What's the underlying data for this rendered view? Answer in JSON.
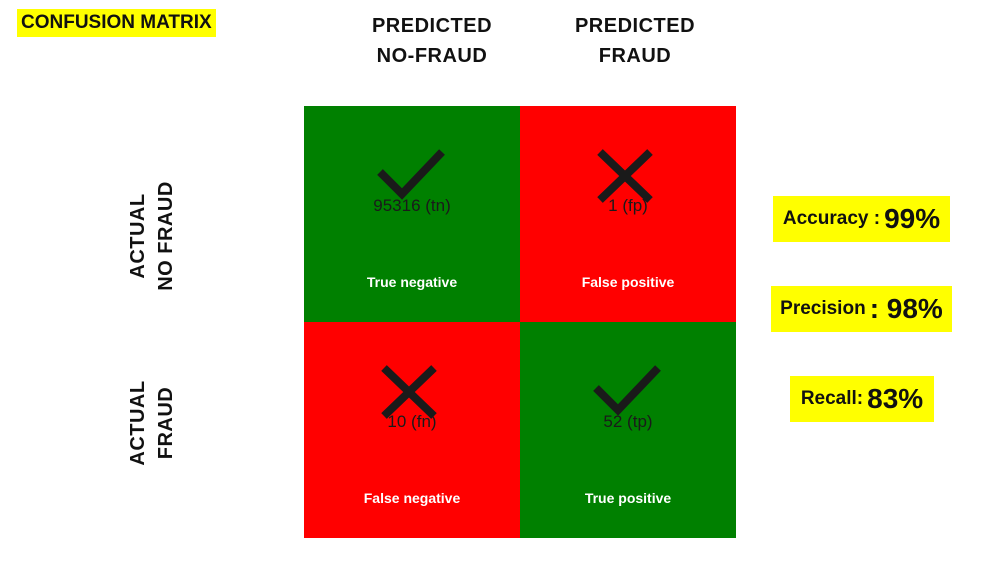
{
  "title": "CONFUSION MATRIX",
  "columns": [
    {
      "line1": "PREDICTED",
      "line2": "NO-FRAUD"
    },
    {
      "line1": "PREDICTED",
      "line2": "FRAUD"
    }
  ],
  "rows": [
    {
      "line1": "ACTUAL",
      "line2": "NO FRAUD"
    },
    {
      "line1": "ACTUAL",
      "line2": "FRAUD"
    }
  ],
  "colors": {
    "correct": "#008000",
    "incorrect": "#ff0000",
    "highlight": "#ffff00",
    "mark": "#1a1a1a"
  },
  "cells": [
    {
      "count": "95316 (tn)",
      "label": "True negative",
      "correct": true,
      "icon": "check-icon"
    },
    {
      "count": "1 (fp)",
      "label": "False positive",
      "correct": false,
      "icon": "cross-icon"
    },
    {
      "count": "10 (fn)",
      "label": "False negative",
      "correct": false,
      "icon": "cross-icon"
    },
    {
      "count": "52 (tp)",
      "label": "True positive",
      "correct": true,
      "icon": "check-icon"
    }
  ],
  "metrics": [
    {
      "label": "Accuracy : ",
      "value": "99%"
    },
    {
      "label": "Precision",
      "value": ": 98%"
    },
    {
      "label": "Recall: ",
      "value": "83%"
    }
  ]
}
